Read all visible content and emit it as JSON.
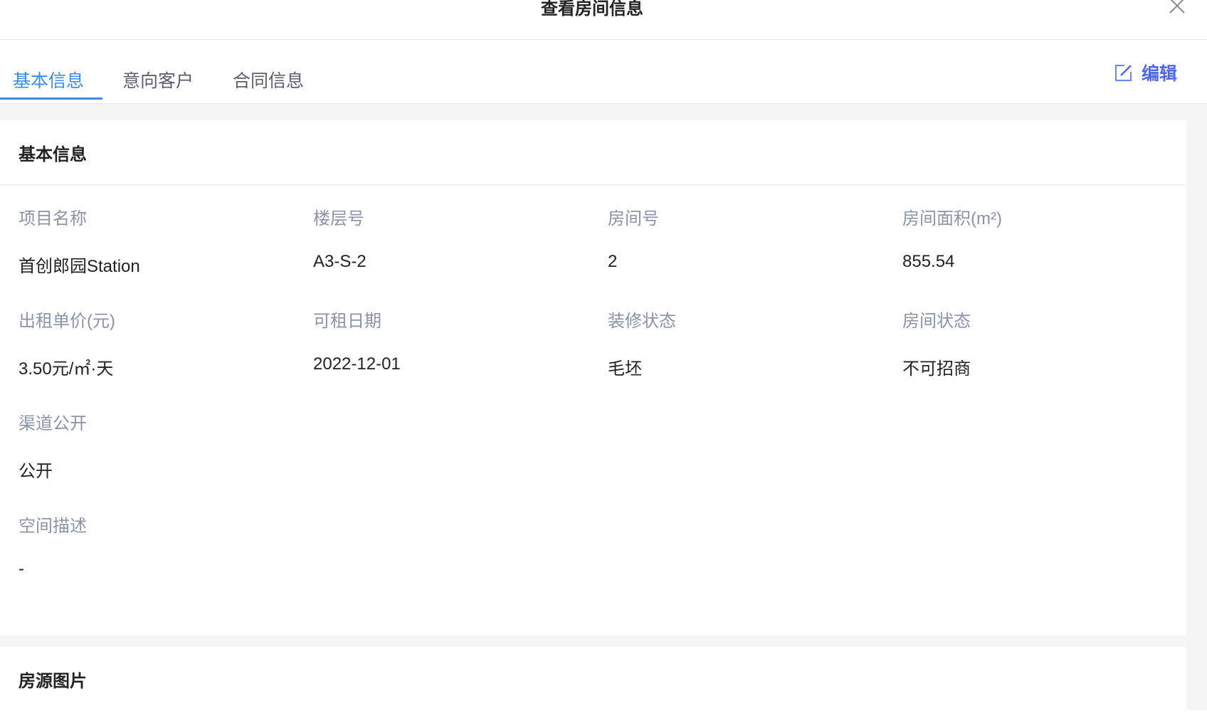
{
  "dialog": {
    "title": "查看房间信息"
  },
  "tabs": [
    {
      "label": "基本信息",
      "active": true
    },
    {
      "label": "意向客户"
    },
    {
      "label": "合同信息"
    }
  ],
  "edit_label": "编辑",
  "basic": {
    "title": "基本信息",
    "fields": [
      {
        "label": "项目名称",
        "value": "首创郎园Station"
      },
      {
        "label": "楼层号",
        "value": "A3-S-2"
      },
      {
        "label": "房间号",
        "value": "2"
      },
      {
        "label": "房间面积(m²)",
        "value": "855.54"
      },
      {
        "label": "出租单价(元)",
        "value": "3.50元/㎡·天"
      },
      {
        "label": "可租日期",
        "value": "2022-12-01"
      },
      {
        "label": "装修状态",
        "value": "毛坯"
      },
      {
        "label": "房间状态",
        "value": "不可招商"
      },
      {
        "label": "渠道公开",
        "value": "公开"
      },
      {
        "label": "空间描述",
        "value": "-"
      }
    ]
  },
  "photos": {
    "title": "房源图片"
  },
  "colors": {
    "accent": "#3b8beb",
    "edit": "#4a68e8"
  }
}
